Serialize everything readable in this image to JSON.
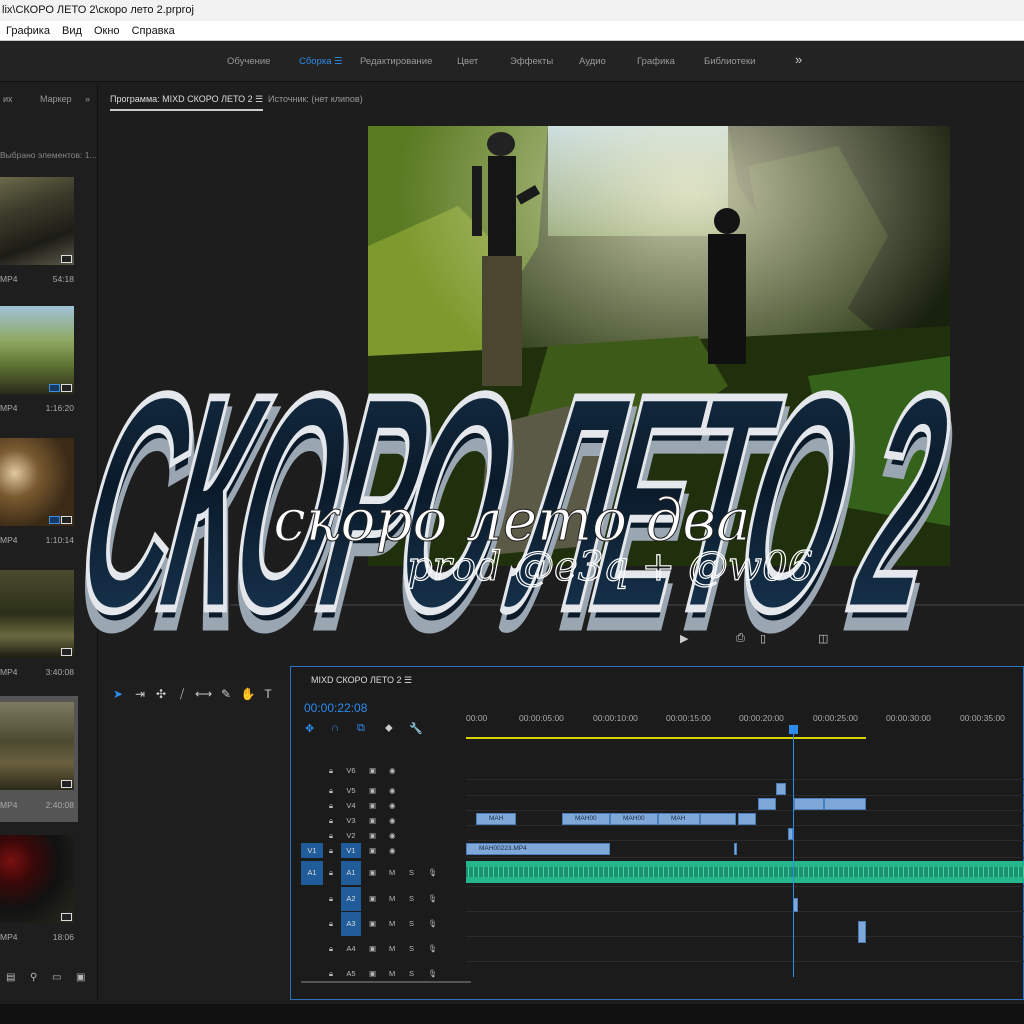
{
  "window": {
    "title": "lix\\СКОРО ЛЕТО 2\\скоро лето 2.prproj"
  },
  "menu": [
    "Графика",
    "Вид",
    "Окно",
    "Справка"
  ],
  "workspaces": [
    {
      "label": "Обучение",
      "active": false
    },
    {
      "label": "Сборка",
      "active": true
    },
    {
      "label": "Редактирование",
      "active": false
    },
    {
      "label": "Цвет",
      "active": false
    },
    {
      "label": "Эффекты",
      "active": false
    },
    {
      "label": "Аудио",
      "active": false
    },
    {
      "label": "Графика",
      "active": false
    },
    {
      "label": "Библиотеки",
      "active": false
    }
  ],
  "workspaces_more": "»",
  "project_panel": {
    "tabs": [
      "их",
      "Маркер",
      "»"
    ],
    "selection": "Выбрано элементов: 1...",
    "items": [
      {
        "format": "MP4",
        "duration": "54:18"
      },
      {
        "format": "MP4",
        "duration": "1:16:20"
      },
      {
        "format": "MP4",
        "duration": "1:10:14"
      },
      {
        "format": "MP4",
        "duration": "3:40:08"
      },
      {
        "format": "MP4",
        "duration": "2:40:08"
      },
      {
        "format": "MP4",
        "duration": "18:06"
      }
    ]
  },
  "program_monitor": {
    "tab_label": "Программа: MIXD СКОРО ЛЕТО 2 ☰",
    "source_tab_label": "Источник: (нет клипов)"
  },
  "overlay_text": {
    "main": "СКОРО ЛЕТО 2",
    "subtitle": "скоро лето два",
    "credit": "prod @e3q + @w06"
  },
  "timeline": {
    "tab_label": "MIXD СКОРО ЛЕТО 2 ☰",
    "timecode": "00:00:22:08",
    "ruler": [
      "00:00",
      "00:00:05:00",
      "00:00:10:00",
      "00:00:15:00",
      "00:00:20:00",
      "00:00:25:00",
      "00:00:30:00",
      "00:00:35:00"
    ],
    "video_tracks": [
      "V6",
      "V5",
      "V4",
      "V3",
      "V2",
      "V1"
    ],
    "audio_tracks": [
      "A1",
      "A2",
      "A3",
      "A4",
      "A5"
    ],
    "source_v": "V1",
    "source_a": "A1",
    "mute_label": "M",
    "solo_label": "S",
    "clip_labels": [
      "МАН",
      "МАН00",
      "МАН00",
      "МАН",
      "МАН00223.MP4"
    ]
  },
  "colors": {
    "accent": "#2d8ceb",
    "audio_clip": "#27b58c",
    "video_clip": "#7fa8d8",
    "workbar": "#d7d200"
  }
}
